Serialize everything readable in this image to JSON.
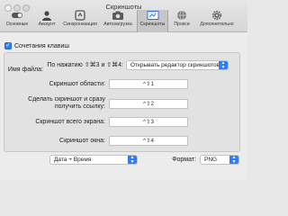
{
  "window": {
    "title": "Скриншоты"
  },
  "toolbar": {
    "tabs": [
      {
        "label": "Основные",
        "icon": "switch-icon",
        "active": false
      },
      {
        "label": "Аккаунт",
        "icon": "account-icon",
        "active": false
      },
      {
        "label": "Синхронизация",
        "icon": "sync-icon",
        "active": false
      },
      {
        "label": "Автозагрузка",
        "icon": "camera-icon",
        "active": false
      },
      {
        "label": "Скриншоты",
        "icon": "screenshot-icon",
        "active": true
      },
      {
        "label": "Прокси",
        "icon": "globe-icon",
        "active": false
      },
      {
        "label": "Дополнительно",
        "icon": "gear-icon",
        "active": false
      }
    ]
  },
  "shortcuts": {
    "enabled_label": "Сочетания клавиш",
    "press_label": "По нажатию ⇧⌘3 и ⇧⌘4:",
    "press_value": "Открывать редактор скриншотов",
    "rows": [
      {
        "label": "Скриншот области:",
        "hotkey": "^⇧1"
      },
      {
        "label": "Сделать скриншот и сразу получить ссылку:",
        "hotkey": "^⇧2"
      },
      {
        "label": "Скриншот всего экрана:",
        "hotkey": "^⇧3"
      },
      {
        "label": "Скриншот окна:",
        "hotkey": "^⇧4"
      }
    ]
  },
  "file": {
    "name_label": "Имя файла:",
    "name_value": "Дата + Время",
    "format_label": "Формат:",
    "format_value": "PNG"
  },
  "colors": {
    "accent": "#2e7cf6"
  }
}
